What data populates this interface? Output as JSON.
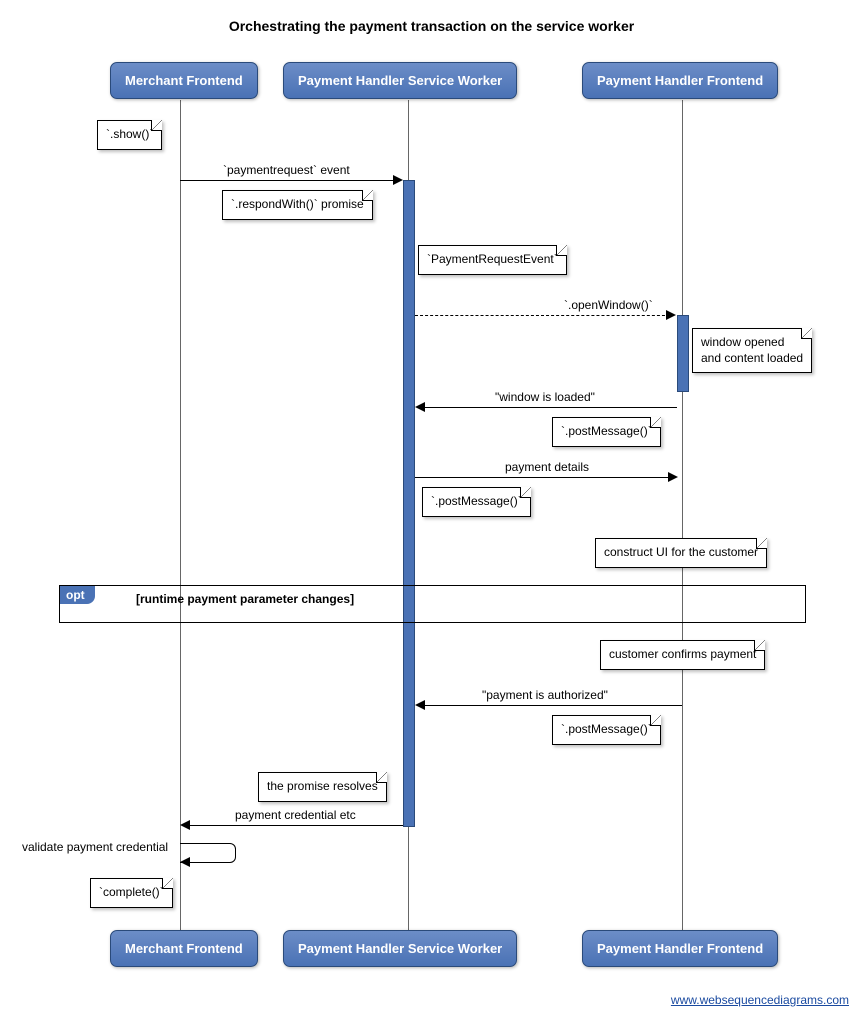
{
  "title": "Orchestrating the payment transaction on the service worker",
  "participants": {
    "merchant": "Merchant Frontend",
    "sw": "Payment Handler Service Worker",
    "frontend": "Payment Handler Frontend"
  },
  "notes": {
    "show": "`.show()`",
    "respondWith": "`.respondWith()` promise",
    "pre": "`PaymentRequestEvent`",
    "windowOpened1": "window opened",
    "windowOpened2": "and content loaded",
    "postMsg1": "`.postMessage()`",
    "postMsg2": "`.postMessage()`",
    "constructUI": "construct UI for the customer",
    "customerConfirms": "customer confirms payment",
    "postMsg3": "`.postMessage()`",
    "promiseResolves": "the promise resolves",
    "complete": "`complete()`"
  },
  "messages": {
    "paymentRequest": "`paymentrequest` event",
    "openWindow": "`.openWindow()`",
    "windowLoaded": "\"window is loaded\"",
    "paymentDetails": "payment details",
    "paymentAuthorized": "\"payment is authorized\"",
    "paymentCredential": "payment credential etc",
    "validate": "validate payment credential"
  },
  "opt": {
    "label": "opt",
    "text": "[runtime payment parameter changes]"
  },
  "footer": "www.websequencediagrams.com"
}
